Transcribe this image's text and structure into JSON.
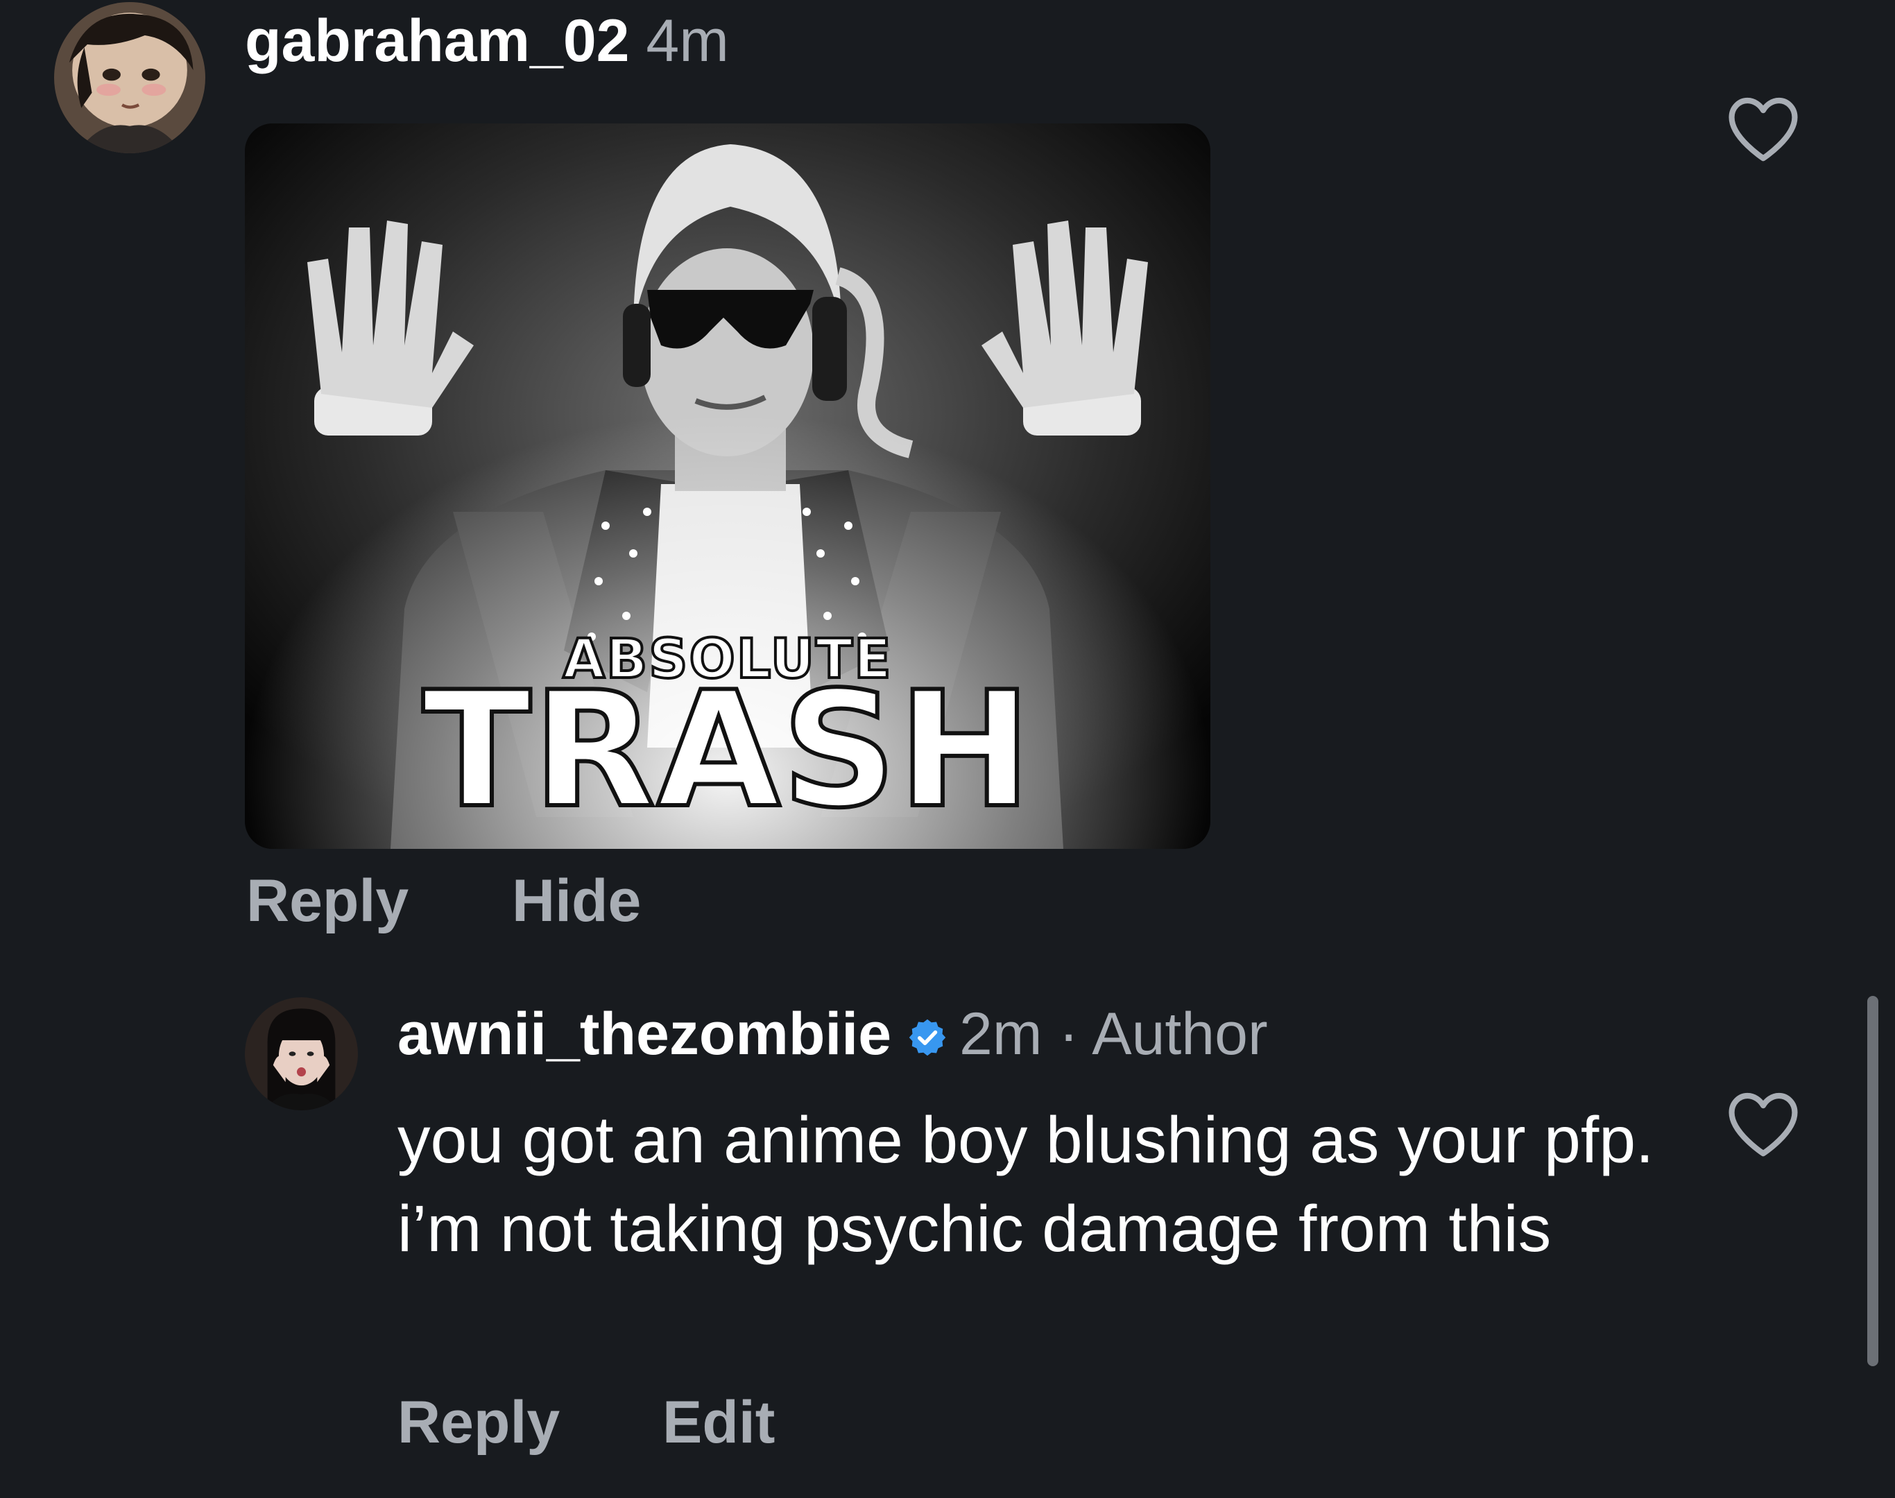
{
  "comments": [
    {
      "username": "gabraham_02",
      "time": "4m",
      "avatar_icon": "anime-boy-blushing-avatar",
      "attachment": {
        "overlay_small": "ABSOLUTE",
        "overlay_big": "TRASH"
      },
      "actions": {
        "reply": "Reply",
        "hide": "Hide"
      },
      "like_icon": "heart-outline-icon"
    },
    {
      "username": "awnii_thezombiie",
      "verified": true,
      "time": "2m",
      "separator": "·",
      "role": "Author",
      "avatar_icon": "profile-photo-avatar",
      "text": "you got an anime boy blushing as your pfp. i’m not taking psychic damage from this",
      "actions": {
        "reply": "Reply",
        "edit": "Edit"
      },
      "like_icon": "heart-outline-icon"
    }
  ],
  "colors": {
    "background": "#181b1f",
    "primary_text": "#ffffff",
    "secondary_text": "#a8adb4",
    "verified_badge": "#3897f0"
  }
}
